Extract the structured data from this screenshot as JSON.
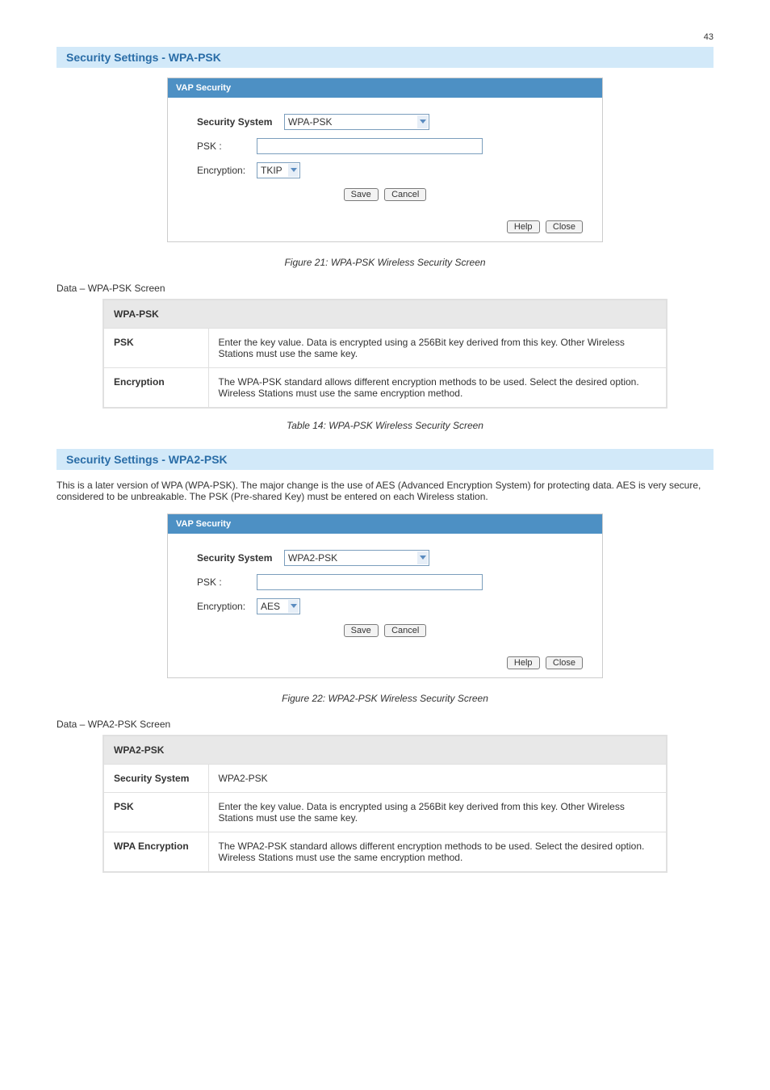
{
  "page_number": "43",
  "sections": [
    {
      "heading": "Security Settings - WPA-PSK",
      "dialog": {
        "title": "VAP Security",
        "security_label": "Security System",
        "security_value": "WPA-PSK",
        "psk_label": "PSK :",
        "psk_value": "",
        "enc_label": "Encryption:",
        "enc_value": "TKIP",
        "save": "Save",
        "cancel": "Cancel",
        "help": "Help",
        "close": "Close"
      },
      "figure": "Figure 21: WPA-PSK Wireless Security Screen",
      "intro": "Data – WPA-PSK Screen",
      "table_header": "WPA-PSK",
      "rows": [
        {
          "label": "PSK",
          "desc": "Enter the key value. Data is encrypted using a 256Bit key derived from this key. Other Wireless Stations must use the same key."
        },
        {
          "label": "Encryption",
          "desc": "The WPA-PSK standard allows different encryption methods to be used. Select the desired option. Wireless Stations must use the same encryption method."
        }
      ],
      "table_caption": "Table 14: WPA-PSK Wireless Security Screen"
    },
    {
      "heading": "Security Settings - WPA2-PSK",
      "intro_before": "This is a later version of WPA (WPA-PSK). The major change is the use of AES (Advanced Encryption System) for protecting data. AES is very secure, considered to be unbreakable. The PSK (Pre-shared Key) must be entered on each Wireless station.",
      "dialog": {
        "title": "VAP Security",
        "security_label": "Security System",
        "security_value": "WPA2-PSK",
        "psk_label": "PSK :",
        "psk_value": "",
        "enc_label": "Encryption:",
        "enc_value": "AES",
        "save": "Save",
        "cancel": "Cancel",
        "help": "Help",
        "close": "Close"
      },
      "figure": "Figure 22: WPA2-PSK Wireless Security Screen",
      "intro": "Data – WPA2-PSK Screen",
      "table_header": "WPA2-PSK",
      "rows": [
        {
          "label": "Security System",
          "desc": "WPA2-PSK"
        },
        {
          "label": "PSK",
          "desc": "Enter the key value. Data is encrypted using a 256Bit key derived from this key. Other Wireless Stations must use the same key."
        },
        {
          "label": "WPA Encryption",
          "desc": "The WPA2-PSK standard allows different encryption methods to be used. Select the desired option. Wireless Stations must use the same encryption method."
        }
      ]
    }
  ]
}
